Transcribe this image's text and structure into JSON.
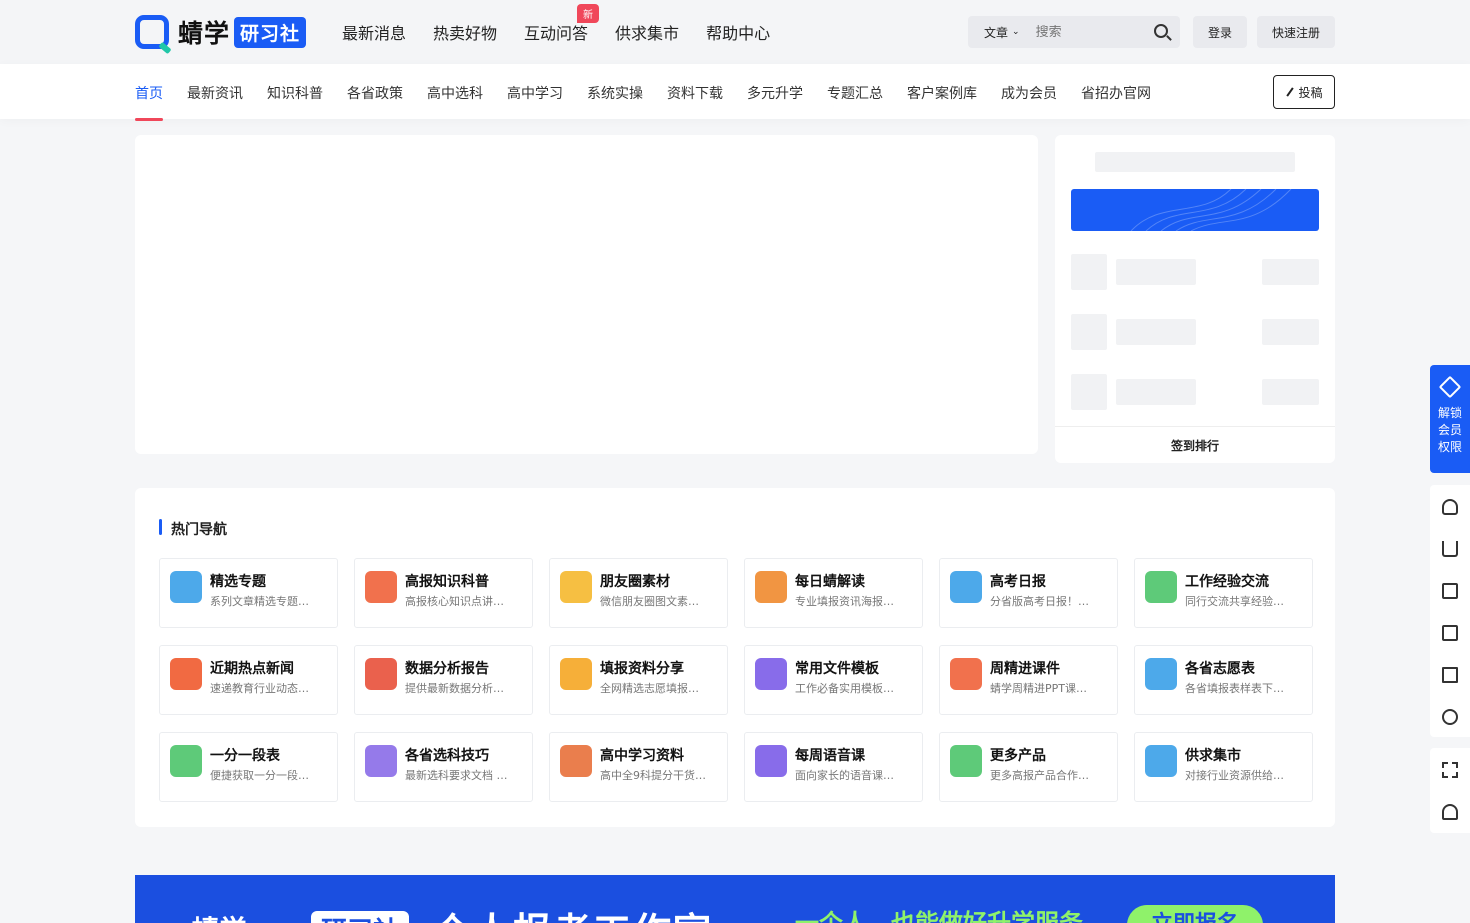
{
  "header": {
    "logo_text": "蜻学",
    "logo_badge": "研习社",
    "nav": [
      "最新消息",
      "热卖好物",
      "互动问答",
      "供求集市",
      "帮助中心"
    ],
    "new_tag": "新",
    "search": {
      "type": "文章",
      "placeholder": "搜索"
    },
    "login_label": "登录",
    "register_label": "快速注册"
  },
  "subnav": {
    "items": [
      "首页",
      "最新资讯",
      "知识科普",
      "各省政策",
      "高中选科",
      "高中学习",
      "系统实操",
      "资料下载",
      "多元升学",
      "专题汇总",
      "客户案例库",
      "成为会员",
      "省招办官网"
    ],
    "active": "首页",
    "submit_label": "投稿"
  },
  "side_card": {
    "footer_label": "签到排行"
  },
  "hot_nav": {
    "title": "热门导航",
    "tiles": [
      {
        "title": "精选专题",
        "desc": "系列文章精选专题…",
        "icon": "topic-icon",
        "color": "#3aa0e8"
      },
      {
        "title": "高报知识科普",
        "desc": "高报核心知识点讲…",
        "icon": "teacher-icon",
        "color": "#f0623a"
      },
      {
        "title": "朋友圈素材",
        "desc": "微信朋友圈图文素…",
        "icon": "aperture-icon",
        "color": "#f5b82e"
      },
      {
        "title": "每日蜻解读",
        "desc": "专业填报资讯海报…",
        "icon": "inbox-icon",
        "color": "#f08a2e"
      },
      {
        "title": "高考日报",
        "desc": "分省版高考日报！…",
        "icon": "screen-icon",
        "color": "#3aa0e8"
      },
      {
        "title": "工作经验交流",
        "desc": "同行交流共享经验…",
        "icon": "chat-icon",
        "color": "#4cc46a"
      },
      {
        "title": "近期热点新闻",
        "desc": "速递教育行业动态…",
        "icon": "fire-icon",
        "color": "#f05a2e"
      },
      {
        "title": "数据分析报告",
        "desc": "提供最新数据分析…",
        "icon": "chart-icon",
        "color": "#e8503a"
      },
      {
        "title": "填报资料分享",
        "desc": "全网精选志愿填报…",
        "icon": "box-icon",
        "color": "#f5a623"
      },
      {
        "title": "常用文件模板",
        "desc": "工作必备实用模板…",
        "icon": "folder-icon",
        "color": "#7b5ce8"
      },
      {
        "title": "周精进课件",
        "desc": "蜻学周精进PPT课…",
        "icon": "ppt-icon",
        "color": "#f0623a"
      },
      {
        "title": "各省志愿表",
        "desc": "各省填报表样表下…",
        "icon": "form-icon",
        "color": "#3aa0e8"
      },
      {
        "title": "一分一段表",
        "desc": "便捷获取一分一段…",
        "icon": "table-icon",
        "color": "#4cc46a"
      },
      {
        "title": "各省选科技巧",
        "desc": "最新选科要求文档 …",
        "icon": "book-icon",
        "color": "#8a6ce8"
      },
      {
        "title": "高中学习资料",
        "desc": "高中全9科提分干货…",
        "icon": "books-icon",
        "color": "#e8703a"
      },
      {
        "title": "每周语音课",
        "desc": "面向家长的语音课…",
        "icon": "mic-icon",
        "color": "#7b5ce8"
      },
      {
        "title": "更多产品",
        "desc": "更多高报产品合作…",
        "icon": "check-icon",
        "color": "#4cc46a"
      },
      {
        "title": "供求集市",
        "desc": "对接行业资源供给…",
        "icon": "puzzle-icon",
        "color": "#3aa0e8"
      }
    ]
  },
  "bottom_banner": {
    "logo": "蜻学",
    "badge": "研习社",
    "headline": "个人报考工作室",
    "sub": "一个人，也能做好升学服务",
    "button": "立即报名"
  },
  "float": {
    "vip_label": "解锁会员权限"
  }
}
